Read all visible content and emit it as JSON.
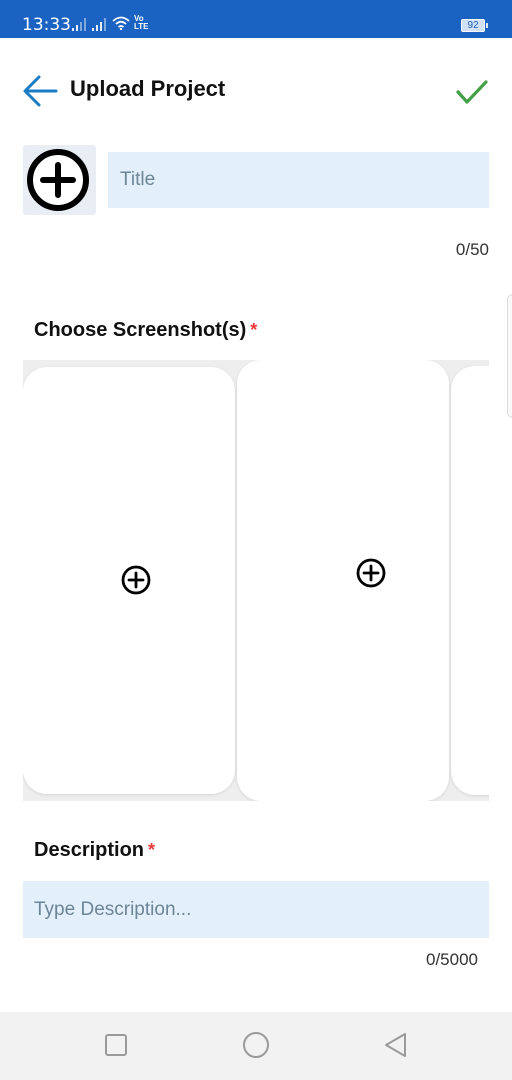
{
  "status_bar": {
    "time": "13:33",
    "battery": "92",
    "network_label": "Vo LTE"
  },
  "header": {
    "title": "Upload Project",
    "back_icon": "arrow-left-icon",
    "confirm_icon": "check-icon",
    "accent_color": "#1a7cc4",
    "confirm_color": "#43a047"
  },
  "title_field": {
    "placeholder": "Title",
    "value": "",
    "counter": "0/50",
    "thumbnail_icon": "plus-circle-icon"
  },
  "screenshots": {
    "label": "Choose Screenshot(s)",
    "required_marker": "*",
    "slots": [
      {
        "icon": "plus-circle-icon"
      },
      {
        "icon": "plus-circle-icon"
      },
      {
        "icon": "plus-circle-icon"
      }
    ]
  },
  "description": {
    "label": "Description",
    "required_marker": "*",
    "placeholder": "Type Description...",
    "value": "",
    "counter": "0/5000"
  },
  "nav_bar": {
    "recent_icon": "square-icon",
    "home_icon": "circle-icon",
    "back_icon": "triangle-back-icon"
  },
  "colors": {
    "status_bar": "#1a63c2",
    "input_bg": "#e3f0fb",
    "required": "#e53935"
  }
}
